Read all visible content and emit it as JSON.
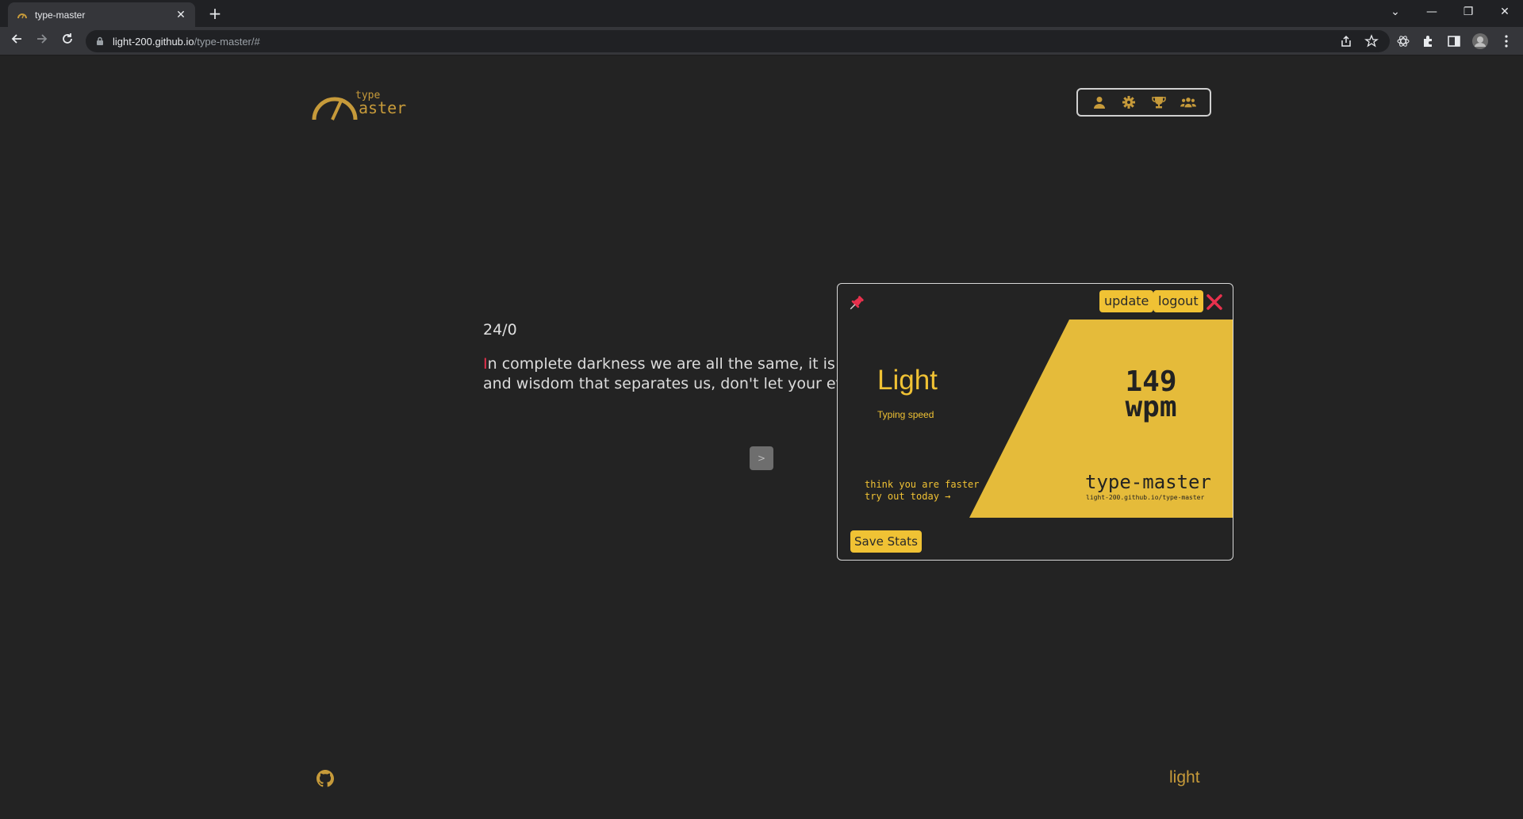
{
  "browser": {
    "tab_title": "type-master",
    "tab_close": "✕",
    "new_tab": "+",
    "url_host": "light-200.github.io",
    "url_path": "/type-master/#",
    "window_controls": [
      "⌄",
      "—",
      "❐",
      "✕"
    ]
  },
  "header": {
    "logo_small": "type",
    "logo_big": "aster",
    "nav_icons": [
      "user-icon",
      "gear-icon",
      "trophy-icon",
      "users-icon"
    ]
  },
  "typing": {
    "counter": "24/0",
    "current_char": "I",
    "line1_rest": "n complete darkness we are all the same, it is only our knowledge",
    "line2": "and wisdom that separates us, don't let your eyes deceive you.",
    "next_button": ">"
  },
  "modal": {
    "update_label": "update",
    "logout_label": "logout",
    "user_name": "Light",
    "subtitle": "Typing speed",
    "wpm_value": "149",
    "wpm_unit": "wpm",
    "tagline_1": "think you are faster",
    "tagline_2": "try out today →",
    "brand": "type-master",
    "brand_url": "light-200.github.io/type-master",
    "save_label": "Save Stats",
    "accent_color": "#f0c234",
    "close_color": "#e8314d"
  },
  "footer": {
    "username": "light"
  }
}
